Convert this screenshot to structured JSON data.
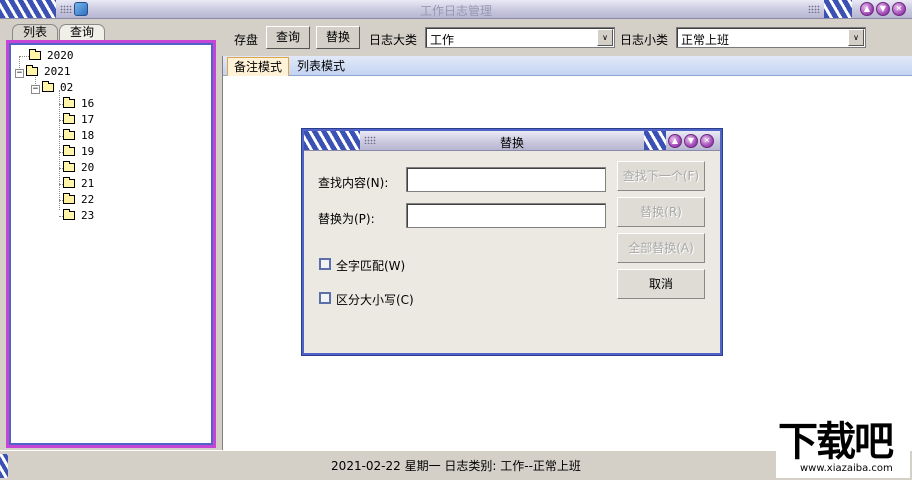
{
  "window": {
    "title": "工作日志管理"
  },
  "left_tabs": [
    "列表",
    "查询"
  ],
  "tree": {
    "years": [
      {
        "label": "2020"
      },
      {
        "label": "2021",
        "expander": "−"
      }
    ],
    "month": {
      "label": "02",
      "expander": "−"
    },
    "days": [
      "16",
      "17",
      "18",
      "19",
      "20",
      "21",
      "22",
      "23"
    ],
    "open_day": "22"
  },
  "toolbar": {
    "save_label": "存盘",
    "query_label": "查询",
    "replace_label": "替换",
    "category_label": "日志大类",
    "category_value": "工作",
    "subcategory_label": "日志小类",
    "subcategory_value": "正常上班",
    "drop_glyph": "∨"
  },
  "content_tabs": [
    "备注模式",
    "列表模式"
  ],
  "dialog": {
    "title": "替换",
    "find_label": "查找内容(N):",
    "replace_label": "替换为(P):",
    "whole_word_label": "全字匹配(W)",
    "match_case_label": "区分大小写(C)",
    "find_next_label": "查找下一个(F)",
    "replace_button_label": "替换(R)",
    "replace_all_label": "全部替换(A)",
    "cancel_label": "取消",
    "find_value": "",
    "replace_value": ""
  },
  "status": {
    "text": "2021-02-22 星期一 日志类别: 工作--正常上班"
  },
  "watermark": {
    "big": "下载吧",
    "small": "www.xiazaiba.com"
  },
  "colors": {
    "accent_border": "#c545d4",
    "inner_border": "#4f63c9",
    "title_stripe": "#3b52b4"
  }
}
